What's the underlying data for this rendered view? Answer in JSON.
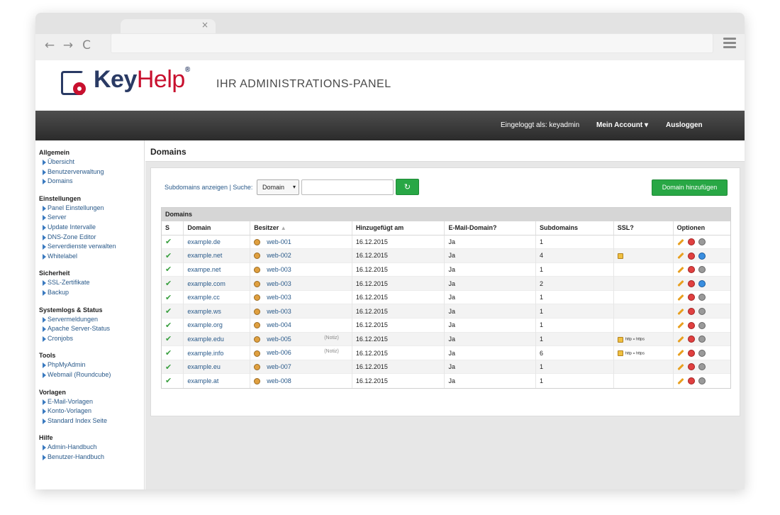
{
  "browser": {
    "tab_close": "×",
    "back": "←",
    "forward": "→",
    "reload": "C"
  },
  "header": {
    "logo_key": "Key",
    "logo_help": "Help",
    "logo_reg": "®",
    "tagline": "IHR ADMINISTRATIONS-PANEL"
  },
  "topbar": {
    "logged_in": "Eingeloggt als: keyadmin",
    "account": "Mein Account ▾",
    "logout": "Ausloggen"
  },
  "sidebar": [
    {
      "title": "Allgemein",
      "items": [
        "Übersicht",
        "Benutzerverwaltung",
        "Domains"
      ]
    },
    {
      "title": "Einstellungen",
      "items": [
        "Panel Einstellungen",
        "Server",
        "Update Intervalle",
        "DNS-Zone Editor",
        "Serverdienste verwalten",
        "Whitelabel"
      ]
    },
    {
      "title": "Sicherheit",
      "items": [
        "SSL-Zertifikate",
        "Backup"
      ]
    },
    {
      "title": "Systemlogs & Status",
      "items": [
        "Servermeldungen",
        "Apache Server-Status",
        "Cronjobs"
      ]
    },
    {
      "title": "Tools",
      "items": [
        "PhpMyAdmin",
        "Webmail (Roundcube)"
      ]
    },
    {
      "title": "Vorlagen",
      "items": [
        "E-Mail-Vorlagen",
        "Konto-Vorlagen",
        "Standard Index Seite"
      ]
    },
    {
      "title": "Hilfe",
      "items": [
        "Admin-Handbuch",
        "Benutzer-Handbuch"
      ]
    }
  ],
  "main": {
    "title": "Domains",
    "filter_label": "Subdomains anzeigen | Suche:",
    "select_value": "Domain",
    "select_arrow": "▾",
    "refresh": "↻",
    "add_button": "Domain hinzufügen",
    "table_caption": "Domains",
    "columns": [
      "S",
      "Domain",
      "Besitzer",
      "Hinzugefügt am",
      "E-Mail-Domain?",
      "Subdomains",
      "SSL?",
      "Optionen"
    ],
    "sort_indicator": "▲",
    "rows": [
      {
        "s": "✔",
        "domain": "example.de",
        "owner": "web-001",
        "note": "",
        "added": "16.12.2015",
        "email": "Ja",
        "subdomains": "1",
        "ssl": "",
        "redirect": "",
        "third": "grey"
      },
      {
        "s": "✔",
        "domain": "example.net",
        "owner": "web-002",
        "note": "",
        "added": "16.12.2015",
        "email": "Ja",
        "subdomains": "4",
        "ssl": "lock",
        "redirect": "",
        "third": "blue"
      },
      {
        "s": "✔",
        "domain": "exampe.net",
        "owner": "web-003",
        "note": "",
        "added": "16.12.2015",
        "email": "Ja",
        "subdomains": "1",
        "ssl": "",
        "redirect": "",
        "third": "grey"
      },
      {
        "s": "✔",
        "domain": "example.com",
        "owner": "web-003",
        "note": "",
        "added": "16.12.2015",
        "email": "Ja",
        "subdomains": "2",
        "ssl": "",
        "redirect": "",
        "third": "blue"
      },
      {
        "s": "✔",
        "domain": "example.cc",
        "owner": "web-003",
        "note": "",
        "added": "16.12.2015",
        "email": "Ja",
        "subdomains": "1",
        "ssl": "",
        "redirect": "",
        "third": "grey"
      },
      {
        "s": "✔",
        "domain": "example.ws",
        "owner": "web-003",
        "note": "",
        "added": "16.12.2015",
        "email": "Ja",
        "subdomains": "1",
        "ssl": "",
        "redirect": "",
        "third": "grey"
      },
      {
        "s": "✔",
        "domain": "example.org",
        "owner": "web-004",
        "note": "",
        "added": "16.12.2015",
        "email": "Ja",
        "subdomains": "1",
        "ssl": "",
        "redirect": "",
        "third": "grey"
      },
      {
        "s": "✔",
        "domain": "example.edu",
        "owner": "web-005",
        "note": "(Notiz)",
        "added": "16.12.2015",
        "email": "Ja",
        "subdomains": "1",
        "ssl": "lock",
        "redirect": "http » https",
        "third": "grey"
      },
      {
        "s": "✔",
        "domain": "example.info",
        "owner": "web-006",
        "note": "(Notiz)",
        "added": "16.12.2015",
        "email": "Ja",
        "subdomains": "6",
        "ssl": "lock",
        "redirect": "http » https",
        "third": "grey"
      },
      {
        "s": "✔",
        "domain": "example.eu",
        "owner": "web-007",
        "note": "",
        "added": "16.12.2015",
        "email": "Ja",
        "subdomains": "1",
        "ssl": "",
        "redirect": "",
        "third": "grey"
      },
      {
        "s": "✔",
        "domain": "example.at",
        "owner": "web-008",
        "note": "",
        "added": "16.12.2015",
        "email": "Ja",
        "subdomains": "1",
        "ssl": "",
        "redirect": "",
        "third": "grey"
      }
    ]
  },
  "colors": {
    "accent": "#28a745",
    "link": "#2a5a8a",
    "brand_dark": "#2a3a64",
    "brand_red": "#c8102e"
  }
}
